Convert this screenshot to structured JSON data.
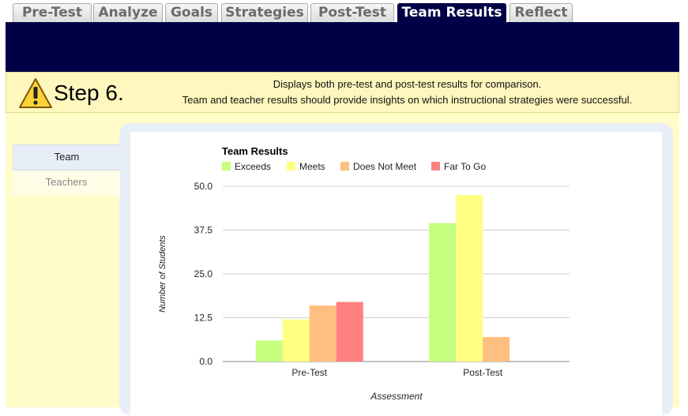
{
  "tabs": [
    {
      "label": "Pre-Test",
      "active": false
    },
    {
      "label": "Analyze",
      "active": false
    },
    {
      "label": "Goals",
      "active": false
    },
    {
      "label": "Strategies",
      "active": false
    },
    {
      "label": "Post-Test",
      "active": false
    },
    {
      "label": "Team Results",
      "active": true
    },
    {
      "label": "Reflect",
      "active": false
    }
  ],
  "step": {
    "icon": "warning-icon",
    "label": "Step 6.",
    "line1": "Displays both pre-test and post-test results for comparison.",
    "line2": "Team and teacher results should provide insights on which instructional strategies were successful."
  },
  "sidenav": {
    "items": [
      {
        "label": "Team",
        "active": true
      },
      {
        "label": "Teachers",
        "active": false
      }
    ]
  },
  "colors": {
    "navy": "#000046",
    "exceeds": "#c6ff7f",
    "meets": "#ffff80",
    "does_not_meet": "#ffbf80",
    "far_to_go": "#ff8080"
  },
  "chart_data": {
    "type": "bar",
    "title": "Team Results",
    "xlabel": "Assessment",
    "ylabel": "Number of Students",
    "categories": [
      "Pre-Test",
      "Post-Test"
    ],
    "series": [
      {
        "name": "Exceeds",
        "values": [
          6,
          39.5
        ],
        "color": "#c6ff7f"
      },
      {
        "name": "Meets",
        "values": [
          12,
          47.5
        ],
        "color": "#ffff80"
      },
      {
        "name": "Does Not Meet",
        "values": [
          16,
          7
        ],
        "color": "#ffbf80"
      },
      {
        "name": "Far To Go",
        "values": [
          17,
          0
        ],
        "color": "#ff8080"
      }
    ],
    "yticks": [
      "0.0",
      "12.5",
      "25.0",
      "37.5",
      "50.0"
    ],
    "ylim": [
      0,
      50
    ],
    "grid": true,
    "legend": "top-left"
  }
}
